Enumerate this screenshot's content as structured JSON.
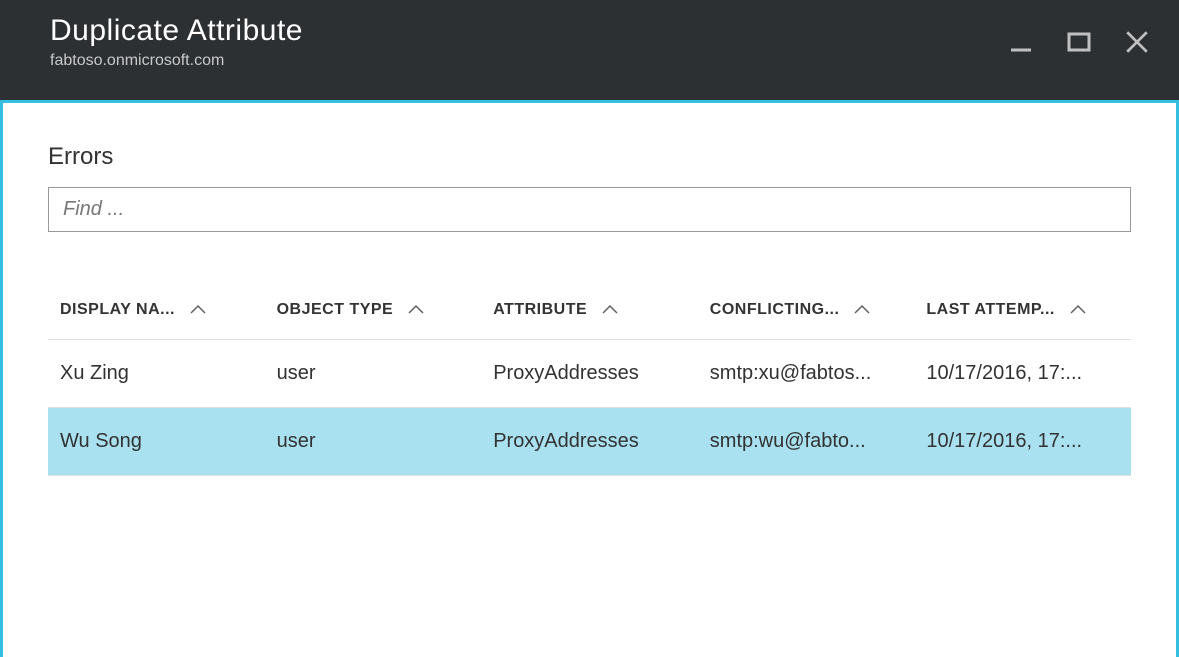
{
  "header": {
    "title": "Duplicate Attribute",
    "subtitle": "fabtoso.onmicrosoft.com"
  },
  "section": {
    "title": "Errors"
  },
  "search": {
    "placeholder": "Find ..."
  },
  "table": {
    "columns": [
      {
        "label": "DISPLAY NA..."
      },
      {
        "label": "OBJECT TYPE"
      },
      {
        "label": "ATTRIBUTE"
      },
      {
        "label": "CONFLICTING..."
      },
      {
        "label": "LAST ATTEMP..."
      }
    ],
    "rows": [
      {
        "display_name": "Xu Zing",
        "object_type": "user",
        "attribute": "ProxyAddresses",
        "conflicting": "smtp:xu@fabtos...",
        "last_attempt": "10/17/2016, 17:...",
        "selected": false
      },
      {
        "display_name": "Wu Song",
        "object_type": "user",
        "attribute": "ProxyAddresses",
        "conflicting": "smtp:wu@fabto...",
        "last_attempt": "10/17/2016, 17:...",
        "selected": true
      }
    ]
  }
}
